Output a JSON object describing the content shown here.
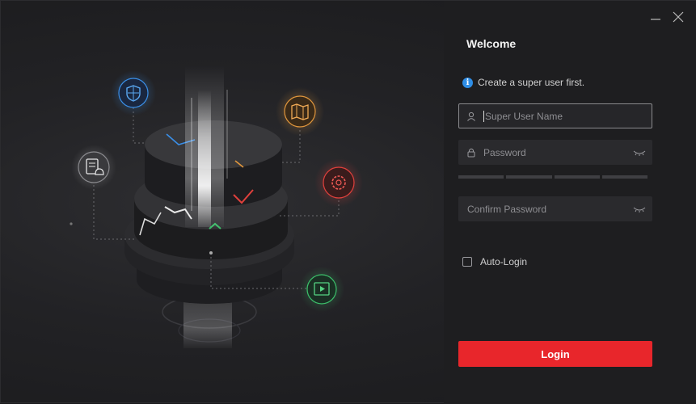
{
  "window": {
    "minimize_icon": "minimize-icon",
    "close_icon": "close-icon"
  },
  "panel": {
    "title": "Welcome",
    "hint": "Create a super user first.",
    "username_placeholder": "Super User Name",
    "password_placeholder": "Password",
    "confirm_placeholder": "Confirm Password",
    "strength_segments": 4,
    "auto_login_label": "Auto-Login",
    "auto_login_checked": false,
    "login_label": "Login"
  },
  "colors": {
    "accent": "#e8262b",
    "info": "#2f8ee6",
    "shield": "#3a8fe8",
    "map": "#e0963c",
    "gear": "#e0403c",
    "video": "#3cbf6a"
  },
  "illustration": {
    "icons": [
      "shield-icon",
      "map-icon",
      "document-bell-icon",
      "gear-icon",
      "video-icon"
    ]
  }
}
